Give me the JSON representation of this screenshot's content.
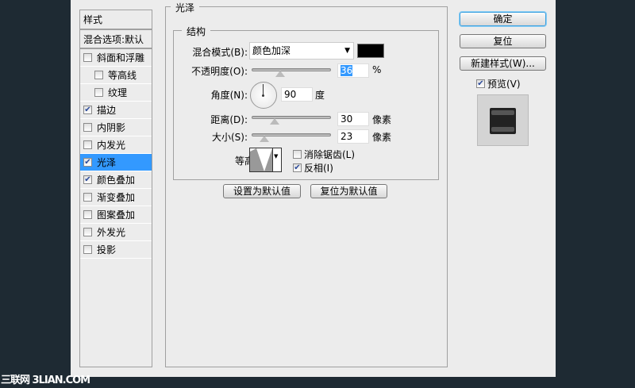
{
  "sidebar": {
    "header": "样式",
    "blend_options": "混合选项:默认",
    "items": [
      {
        "label": "斜面和浮雕",
        "checked": false,
        "indent": false
      },
      {
        "label": "等高线",
        "checked": false,
        "indent": true
      },
      {
        "label": "纹理",
        "checked": false,
        "indent": true
      },
      {
        "label": "描边",
        "checked": true,
        "indent": false
      },
      {
        "label": "内阴影",
        "checked": false,
        "indent": false
      },
      {
        "label": "内发光",
        "checked": false,
        "indent": false
      },
      {
        "label": "光泽",
        "checked": true,
        "indent": false,
        "selected": true
      },
      {
        "label": "颜色叠加",
        "checked": true,
        "indent": false
      },
      {
        "label": "渐变叠加",
        "checked": false,
        "indent": false
      },
      {
        "label": "图案叠加",
        "checked": false,
        "indent": false
      },
      {
        "label": "外发光",
        "checked": false,
        "indent": false
      },
      {
        "label": "投影",
        "checked": false,
        "indent": false
      }
    ]
  },
  "panel": {
    "title": "光泽",
    "structure": "结构",
    "blend_mode_label": "混合模式(B):",
    "blend_mode": "颜色加深",
    "color": "#000000",
    "opacity_label": "不透明度(O):",
    "opacity": "36",
    "opacity_unit": "%",
    "angle_label": "角度(N):",
    "angle": "90",
    "angle_unit": "度",
    "distance_label": "距离(D):",
    "distance": "30",
    "distance_unit": "像素",
    "size_label": "大小(S):",
    "size": "23",
    "size_unit": "像素",
    "contour_label": "等高线:",
    "antialias_label": "消除锯齿(L)",
    "antialias": false,
    "invert_label": "反相(I)",
    "invert": true,
    "make_default": "设置为默认值",
    "reset_default": "复位为默认值"
  },
  "right": {
    "ok": "确定",
    "reset": "复位",
    "new_style": "新建样式(W)...",
    "preview_label": "预览(V)",
    "preview": true
  },
  "watermark": "三联网 3LIAN.COM",
  "colors": {
    "selected": "#3399ff",
    "background": "#1e2a33"
  }
}
